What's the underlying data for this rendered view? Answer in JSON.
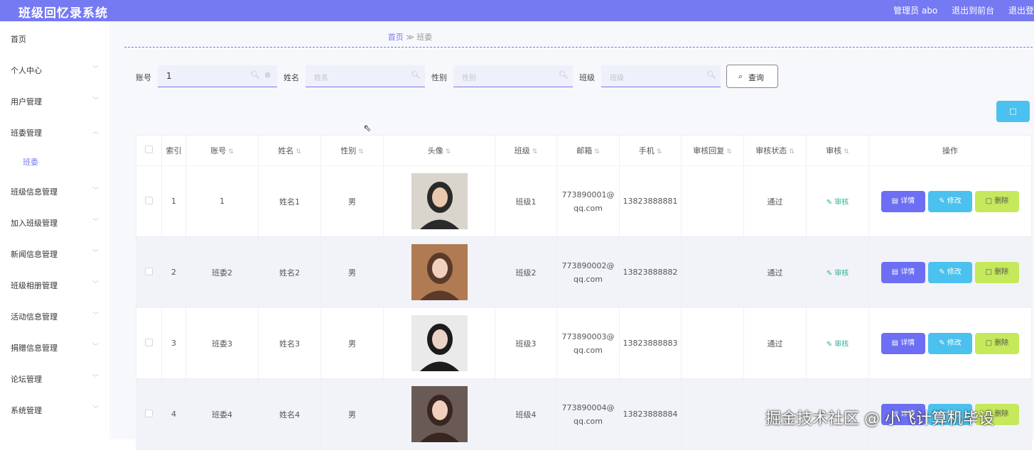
{
  "app": {
    "title": "班级回忆录系统"
  },
  "header": {
    "user": "管理员 abo",
    "to_front": "退出到前台",
    "logout": "退出登"
  },
  "sidebar": {
    "items": [
      {
        "label": "首页"
      },
      {
        "label": "个人中心"
      },
      {
        "label": "用户管理"
      },
      {
        "label": "班委管理"
      },
      {
        "label": "班委"
      },
      {
        "label": "班级信息管理"
      },
      {
        "label": "加入班级管理"
      },
      {
        "label": "新闻信息管理"
      },
      {
        "label": "班级相册管理"
      },
      {
        "label": "活动信息管理"
      },
      {
        "label": "捐赠信息管理"
      },
      {
        "label": "论坛管理"
      },
      {
        "label": "系统管理"
      }
    ]
  },
  "breadcrumb": {
    "home": "首页",
    "sep": "≫",
    "current": "班委"
  },
  "search": {
    "account_label": "账号",
    "account_value": "1",
    "name_label": "姓名",
    "name_placeholder": "姓名",
    "gender_label": "性别",
    "gender_placeholder": "性别",
    "class_label": "班级",
    "class_placeholder": "班级",
    "query_label": "查询"
  },
  "table": {
    "headers": [
      "索引",
      "账号",
      "姓名",
      "性别",
      "头像",
      "班级",
      "邮箱",
      "手机",
      "审核回复",
      "审核状态",
      "审核",
      "操作"
    ],
    "rows": [
      {
        "index": "1",
        "account": "1",
        "name": "姓名1",
        "gender": "男",
        "class": "班级1",
        "email1": "773890001@",
        "email2": "qq.com",
        "phone": "13823888881",
        "reply": "",
        "status": "通过",
        "audit": "审核"
      },
      {
        "index": "2",
        "account": "班委2",
        "name": "姓名2",
        "gender": "男",
        "class": "班级2",
        "email1": "773890002@",
        "email2": "qq.com",
        "phone": "13823888882",
        "reply": "",
        "status": "通过",
        "audit": "审核"
      },
      {
        "index": "3",
        "account": "班委3",
        "name": "姓名3",
        "gender": "男",
        "class": "班级3",
        "email1": "773890003@",
        "email2": "qq.com",
        "phone": "13823888883",
        "reply": "",
        "status": "通过",
        "audit": "审核"
      },
      {
        "index": "4",
        "account": "班委4",
        "name": "姓名4",
        "gender": "男",
        "class": "班级4",
        "email1": "773890004@",
        "email2": "qq.com",
        "phone": "13823888884",
        "reply": "",
        "status": "",
        "audit": ""
      }
    ],
    "actions": {
      "detail": "详情",
      "edit": "修改",
      "delete": "删除"
    }
  },
  "watermark": "掘金技术社区 @ 小飞计算机毕设",
  "colors": {
    "accent": "#7579f2",
    "info": "#4ac1ee",
    "lime": "#c5e95a",
    "audit": "#2ab597"
  }
}
